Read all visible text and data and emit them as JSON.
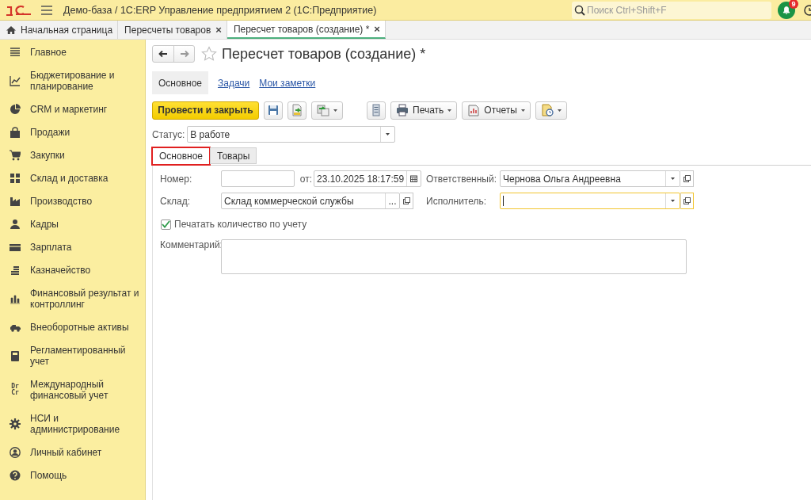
{
  "header": {
    "title": "Демо-база / 1С:ERP Управление предприятием 2  (1С:Предприятие)",
    "search": {
      "placeholder": "Поиск Ctrl+Shift+F"
    },
    "notifications": "9"
  },
  "open_tabs": [
    {
      "label": "Начальная страница",
      "selected": false
    },
    {
      "label": "Пересчеты товаров",
      "close": "×",
      "selected": false
    },
    {
      "label": "Пересчет товаров (создание) *",
      "close": "×",
      "selected": true
    }
  ],
  "sidebar": {
    "items": [
      {
        "label": "Главное"
      },
      {
        "label": "Бюджетирование и планирование"
      },
      {
        "label": "CRM и маркетинг"
      },
      {
        "label": "Продажи"
      },
      {
        "label": "Закупки"
      },
      {
        "label": "Склад и доставка"
      },
      {
        "label": "Производство"
      },
      {
        "label": "Кадры"
      },
      {
        "label": "Зарплата"
      },
      {
        "label": "Казначейство"
      },
      {
        "label": "Финансовый результат и контроллинг"
      },
      {
        "label": "Внеоборотные активы"
      },
      {
        "label": "Регламентированный учет"
      },
      {
        "label": "Международный финансовый учет",
        "icon_text": "Dr Cr"
      },
      {
        "label": "НСИ и администрирование"
      },
      {
        "label": "Личный кабинет"
      },
      {
        "label": "Помощь"
      }
    ]
  },
  "document": {
    "title": "Пересчет товаров (создание) *",
    "sections": [
      {
        "label": "Основное",
        "selected": true
      },
      {
        "label": "Задачи",
        "selected": false
      },
      {
        "label": "Мои заметки",
        "selected": false
      }
    ],
    "toolbar": [
      {
        "kind": "primary",
        "label": "Провести и закрыть"
      },
      {
        "kind": "icon"
      },
      {
        "kind": "icon"
      },
      {
        "kind": "icon-menu"
      },
      {
        "kind": "icon"
      },
      {
        "kind": "menu",
        "label": "Печать"
      },
      {
        "kind": "menu",
        "label": "Отчеты"
      },
      {
        "kind": "icon-menu"
      }
    ],
    "status": {
      "label": "Статус:",
      "value": "В работе"
    },
    "form_tabs": [
      {
        "label": "Основное",
        "selected": true,
        "highlighted": true
      },
      {
        "label": "Товары",
        "selected": false,
        "highlighted": false
      }
    ],
    "number": {
      "label": "Номер:"
    },
    "date": {
      "label": "от:",
      "value": "23.10.2025 18:17:59"
    },
    "responsible": {
      "label": "Ответственный:",
      "value": "Чернова Ольга Андреевна"
    },
    "warehouse": {
      "label": "Склад:",
      "value": "Склад коммерческой службы",
      "choose": "..."
    },
    "executor": {
      "label": "Исполнитель:",
      "focused": true
    },
    "print_by_account": {
      "label": "Печатать количество по учету",
      "checked": true
    },
    "comment": {
      "label": "Комментарий:"
    }
  }
}
